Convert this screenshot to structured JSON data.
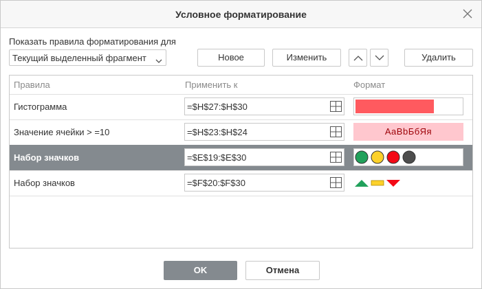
{
  "dialog": {
    "title": "Условное форматирование"
  },
  "show_rules": {
    "label": "Показать правила форматирования для",
    "selected": "Текущий выделенный фрагмент"
  },
  "toolbar": {
    "new_label": "Новое",
    "edit_label": "Изменить",
    "delete_label": "Удалить"
  },
  "table": {
    "headers": [
      "Правила",
      "Применить к",
      "Формат"
    ],
    "rows": [
      {
        "rule": "Гистограмма",
        "range": "=$H$27:$H$30",
        "format_type": "data-bar",
        "bar_color": "#ff5a5f",
        "bar_fraction": 0.73
      },
      {
        "rule": "Значение ячейки > =10",
        "range": "=$H$23:$H$24",
        "format_type": "cell-style",
        "preview_text": "AaBbБбЯя",
        "bg_color": "#ffc7ce",
        "text_color": "#9c0006"
      },
      {
        "rule": "Набор значков",
        "range": "=$E$19:$E$30",
        "format_type": "icon-set",
        "selected": true,
        "icons": [
          "green-circle-icon",
          "yellow-circle-icon",
          "red-circle-icon",
          "black-circle-icon"
        ]
      },
      {
        "rule": "Набор значков",
        "range": "=$F$20:$F$30",
        "format_type": "icon-set",
        "icons": [
          "green-up-triangle-icon",
          "yellow-dash-icon",
          "red-down-triangle-icon"
        ]
      }
    ]
  },
  "footer": {
    "ok_label": "OK",
    "cancel_label": "Отмена"
  },
  "colors": {
    "selected_row": "#848a8f",
    "green": "#21a15b",
    "yellow": "#fcd12a",
    "red": "#f30a16",
    "black": "#4d4d4d"
  }
}
